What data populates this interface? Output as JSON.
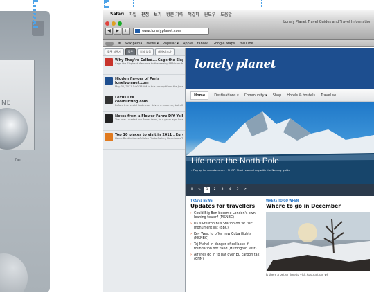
{
  "left_panel": {
    "caption_text": "NE",
    "fan_label": "Fan"
  },
  "menubar": {
    "app_name": "Safari",
    "items": [
      "파일",
      "편집",
      "보기",
      "방문 기록",
      "책갈피",
      "윈도우",
      "도움말"
    ]
  },
  "window": {
    "title": "Lonely Planet Travel Guides and Travel Information"
  },
  "toolbar": {
    "back": "◀",
    "forward": "▶",
    "url": "www.lonelyplanet.com"
  },
  "bookmarks": [
    "Wikipedia",
    "News ▾",
    "Popular ▾",
    "Apple",
    "Yahoo!",
    "Google Maps",
    "YouTube"
  ],
  "reading_list": {
    "controls": [
      "모두 지우기",
      "모두",
      "읽지 않음",
      "페이지 추가"
    ],
    "items": [
      {
        "title": "Why They're Called... Cage the Elephant — spin.com",
        "site": "",
        "desc": "Cage the Elephant Welcome to the weekly SPIN.com feature \"Name That Band!\" in which we get the...",
        "color": "#c8342c"
      },
      {
        "title": "Hidden flavors of Paris",
        "site": "lonelyplanet.com",
        "desc": "May 30, 2011 5:00:33 AM In this excerpt from the June 2010 issue of...",
        "color": "#1d4e8f"
      },
      {
        "title": "Lexus LFA",
        "site": "coolhunting.com",
        "desc": "Before this week I had never driven a supercar, but after two laps behind the wheel of the forthcomin...",
        "color": "#333333"
      },
      {
        "title": "Notes from a Flower Farm: DIY Yellow Fl... — gardendesign.com",
        "site": "",
        "desc": "The year I started my flower farm, four years ago, I was lucky enough to be working in the fields wit...",
        "color": "#222222"
      },
      {
        "title": "Top 10 places to visit in 2011 : Europe/Mi... — roughguides.com",
        "site": "",
        "desc": "Home Destinations Articles Photo Gallery Downloads Travel Services Reference About Us...",
        "color": "#e07a1f"
      }
    ]
  },
  "site": {
    "logo": "lonely planet",
    "nav": [
      "Home",
      "Destinations ▾",
      "Community ▾",
      "Shop",
      "Hotels & hostels",
      "Travel se"
    ],
    "hero_title": "Life near the North Pole",
    "hero_sub": "› Pug up for an adventure   › SHOP: Start researching with the Norway guide",
    "pager": [
      "II",
      "<",
      "1",
      "2",
      "3",
      "4",
      "5",
      ">"
    ],
    "pager_current": "1",
    "news_kicker": "TRAVEL NEWS",
    "news_title": "Updates for travellers",
    "news": [
      "Could Big Ben become London's own leaning tower? (MSNBC)",
      "UK's Preston Bus Station on 'at risk' monument list (BBC)",
      "Key West to offer new Cuba flights (MSNBC)",
      "Taj Mahal in danger of collapse if foundation not fixed (Huffington Post)",
      "Airlines go in to bat over EU carbon tax (CNN)"
    ],
    "where_kicker": "WHERE TO GO WHEN",
    "where_title": "Where to go in December",
    "caption": "Is there a better time to visit Austria than wh"
  }
}
